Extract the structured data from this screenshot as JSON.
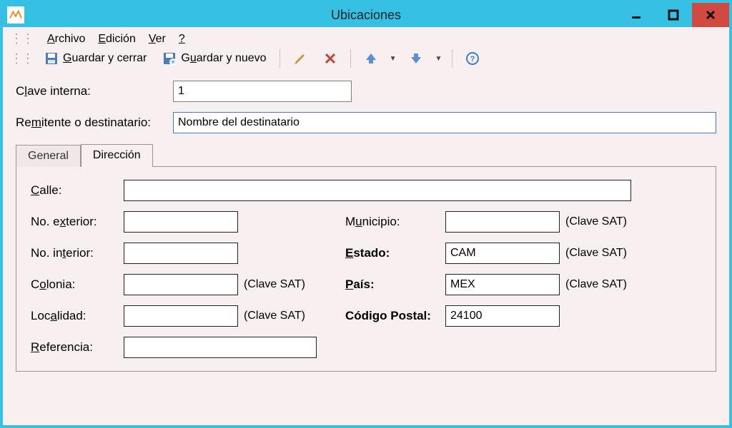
{
  "window": {
    "title": "Ubicaciones"
  },
  "menu": {
    "archivo": "Archivo",
    "edicion": "Edición",
    "ver": "Ver",
    "help": "?"
  },
  "toolbar": {
    "guardar_cerrar": "Guardar y cerrar",
    "guardar_nuevo": "Guardar y nuevo"
  },
  "form": {
    "clave_interna_label": "Clave interna:",
    "clave_interna_value": "1",
    "remitente_label": "Remitente o destinatario:",
    "remitente_value": "Nombre del destinatario"
  },
  "tabs": {
    "general": "General",
    "direccion": "Dirección"
  },
  "direccion": {
    "calle_label": "Calle:",
    "calle_value": "",
    "no_ext_label": "No. exterior:",
    "no_ext_value": "",
    "no_int_label": "No. interior:",
    "no_int_value": "",
    "colonia_label": "Colonia:",
    "colonia_value": "",
    "localidad_label": "Localidad:",
    "localidad_value": "",
    "referencia_label": "Referencia:",
    "referencia_value": "",
    "municipio_label": "Municipio:",
    "municipio_value": "",
    "estado_label": "Estado:",
    "estado_value": "CAM",
    "pais_label": "País:",
    "pais_value": "MEX",
    "cp_label": "Código Postal:",
    "cp_value": "24100",
    "clave_sat": "(Clave SAT)"
  }
}
